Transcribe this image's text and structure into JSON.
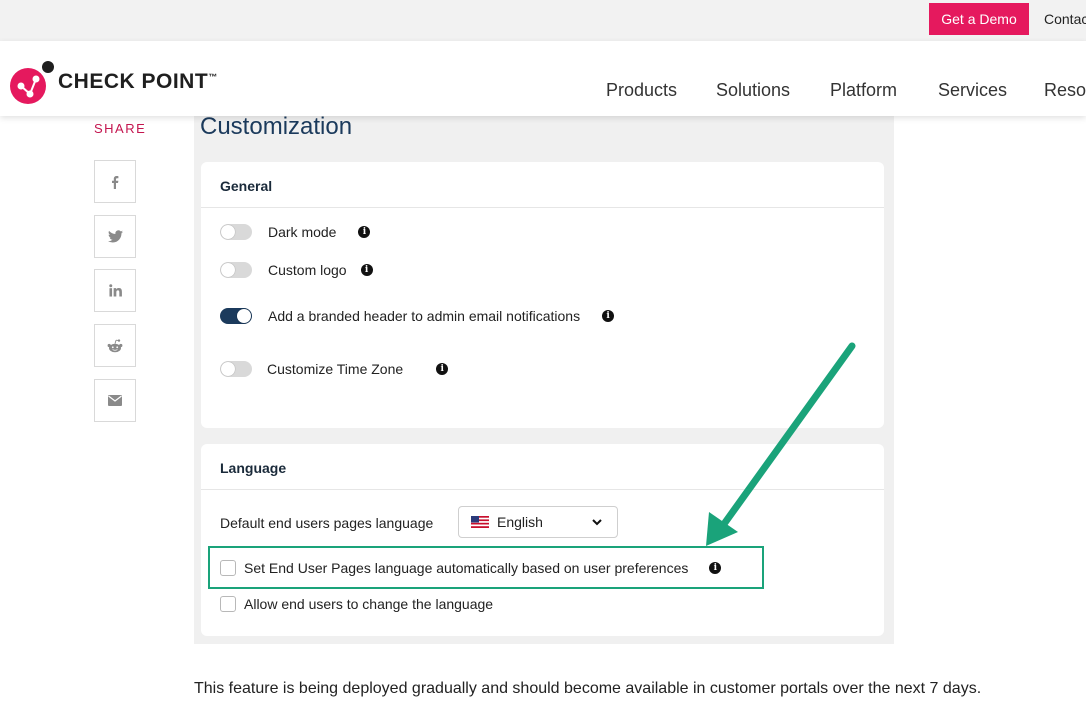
{
  "topbar": {
    "demo_label": "Get a Demo",
    "contact_label": "Contac"
  },
  "header": {
    "logo_text": "CHECK POINT",
    "logo_tm": "™",
    "nav": [
      "Products",
      "Solutions",
      "Platform",
      "Services",
      "Resou"
    ]
  },
  "share": {
    "label": "SHARE",
    "buttons": [
      "facebook-icon",
      "twitter-icon",
      "linkedin-icon",
      "reddit-icon",
      "email-icon"
    ]
  },
  "main": {
    "title": "Customization",
    "general": {
      "title": "General",
      "toggles": [
        {
          "label": "Dark mode",
          "on": false
        },
        {
          "label": "Custom logo",
          "on": false
        },
        {
          "label": "Add a branded header to admin email notifications",
          "on": true
        },
        {
          "label": "Customize Time Zone",
          "on": false
        }
      ]
    },
    "language": {
      "title": "Language",
      "default_label": "Default end users pages language",
      "selected_language": "English",
      "auto_label": "Set End User Pages language automatically based on user preferences",
      "allow_change_label": "Allow end users to change the language"
    },
    "footer_note": "This feature is being deployed gradually and should become available in customer portals over the next 7 days."
  },
  "colors": {
    "brand": "#e5195e",
    "title": "#1b3a5c",
    "annotation": "#1aa37a"
  }
}
